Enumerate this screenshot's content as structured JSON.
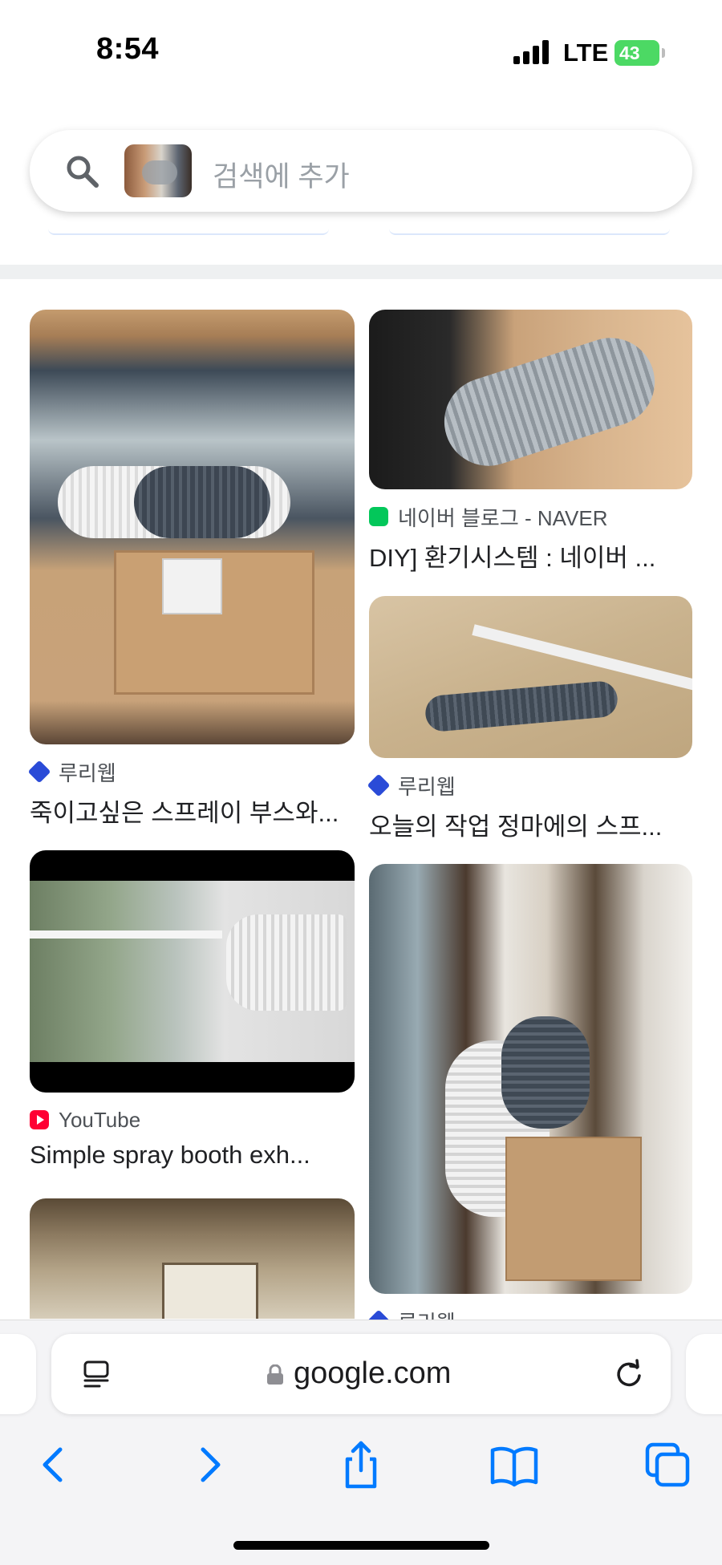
{
  "status_bar": {
    "time": "8:54",
    "network": "LTE",
    "battery": "43"
  },
  "search": {
    "placeholder": "검색에 추가"
  },
  "results": [
    {
      "source": "루리웹",
      "title": "죽이고싶은 스프레이 부스와..."
    },
    {
      "source": "네이버 블로그 - NAVER",
      "title": "DIY] 환기시스템 : 네이버 ..."
    },
    {
      "source": "루리웹",
      "title": "오늘의 작업 정마에의 스프..."
    },
    {
      "source": "YouTube",
      "title": "Simple spray booth exh..."
    },
    {
      "source": "루리웹",
      "title": ""
    }
  ],
  "browser": {
    "url": "google.com"
  },
  "icons": {
    "search": "search-icon",
    "reader": "reader-icon",
    "lock": "lock-icon",
    "reload": "reload-icon",
    "back": "back-icon",
    "forward": "forward-icon",
    "share": "share-icon",
    "bookmarks": "bookmarks-icon",
    "tabs": "tabs-icon"
  },
  "colors": {
    "accent": "#007aff",
    "battery": "#4cd964",
    "divider": "#eef0f1"
  }
}
